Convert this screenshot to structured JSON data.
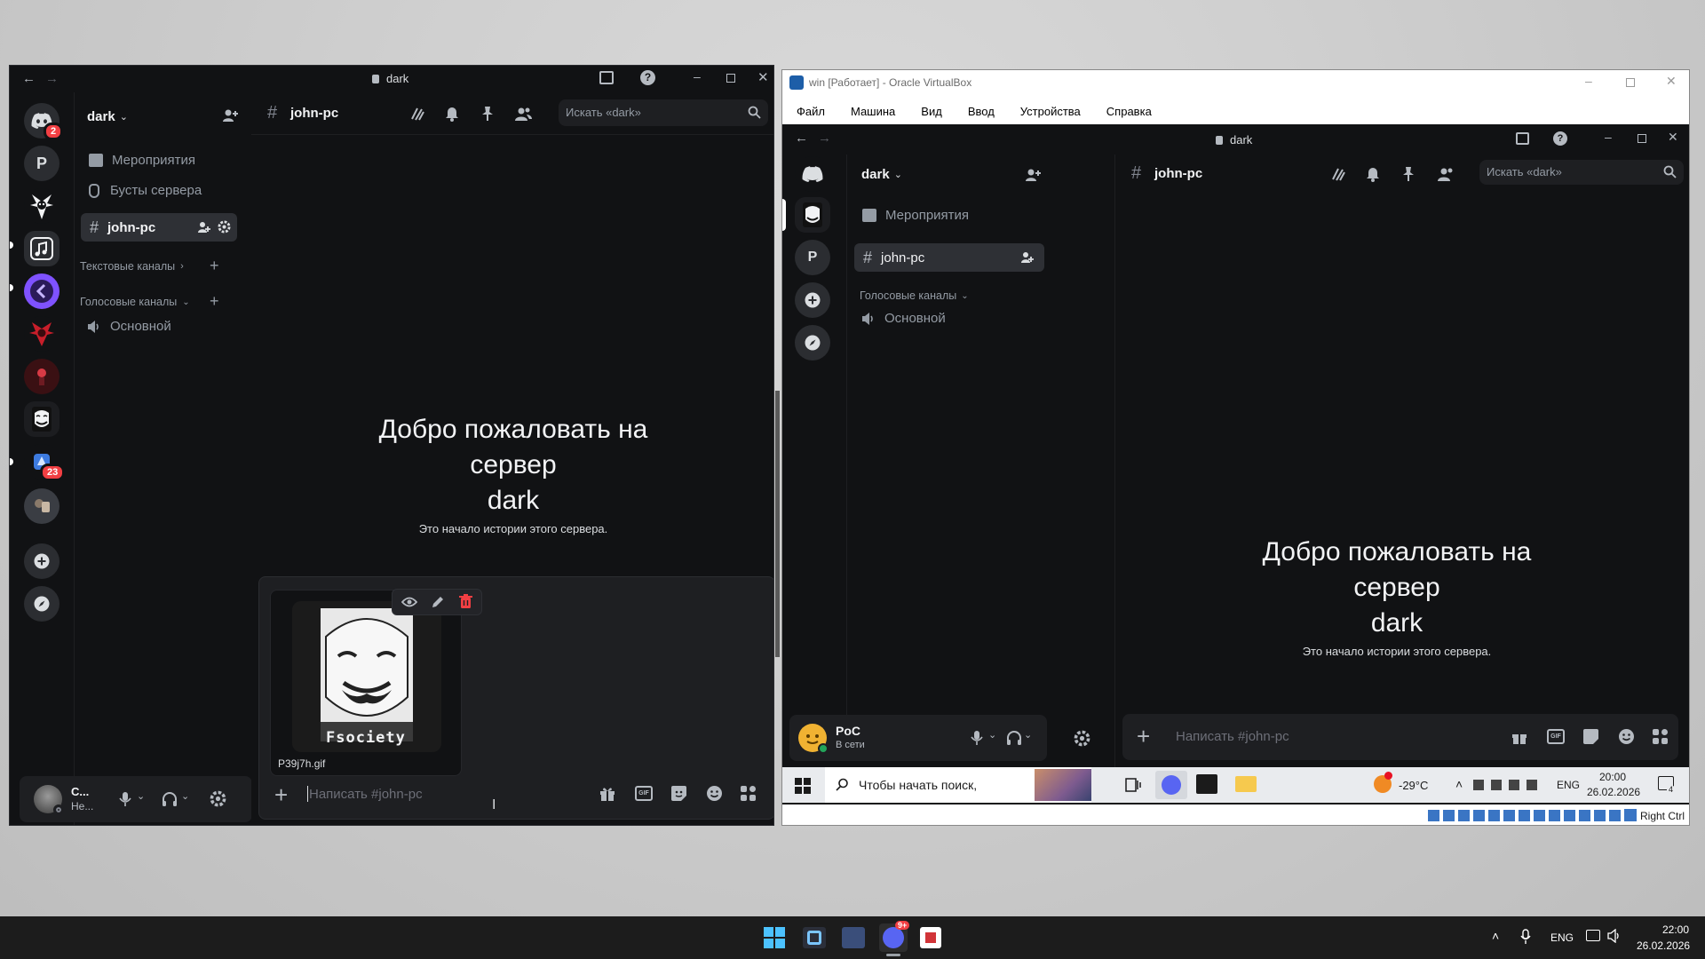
{
  "left_window": {
    "title": "dark",
    "server_name": "dark",
    "channel_name": "john-pc",
    "search_placeholder": "Искать «dark»",
    "events_label": "Мероприятия",
    "boosts_label": "Бусты сервера",
    "selected_channel": "john-pc",
    "text_category": "Текстовые каналы",
    "voice_category": "Голосовые каналы",
    "voice_channel": "Основной",
    "welcome_line1": "Добро пожаловать на",
    "welcome_line2": "сервер",
    "welcome_line3": "dark",
    "welcome_sub": "Это начало истории этого сервера.",
    "attachment_filename": "P39j7h.gif",
    "attachment_caption": "Fsociety",
    "message_placeholder": "Написать #john-pc",
    "user_name": "С...",
    "user_status": "Не...",
    "server_rail": [
      {
        "label": "",
        "badge": "2",
        "icon": "discord-icon"
      },
      {
        "label": "P",
        "badge": "",
        "icon": "letter"
      },
      {
        "label": "",
        "badge": "",
        "icon": "jester-icon"
      },
      {
        "label": "",
        "badge": "",
        "icon": "music-icon"
      },
      {
        "label": "",
        "badge": "",
        "icon": "kotlin-icon"
      },
      {
        "label": "",
        "badge": "",
        "icon": "red-jester-icon"
      },
      {
        "label": "",
        "badge": "",
        "icon": "dark-red-icon"
      },
      {
        "label": "",
        "badge": "",
        "icon": "mask-icon"
      },
      {
        "label": "",
        "badge": "23",
        "icon": "blue-icon"
      },
      {
        "label": "",
        "badge": "",
        "icon": "photo-icon"
      }
    ]
  },
  "vbox_window": {
    "title": "win [Работает] - Oracle VirtualBox",
    "menu": [
      "Файл",
      "Машина",
      "Вид",
      "Ввод",
      "Устройства",
      "Справка"
    ],
    "inner_title": "dark",
    "server_name": "dark",
    "channel_name": "john-pc",
    "search_placeholder": "Искать «dark»",
    "events_label": "Мероприятия",
    "selected_channel": "john-pc",
    "voice_category": "Голосовые каналы",
    "voice_channel": "Основной",
    "welcome_line1": "Добро пожаловать на",
    "welcome_line2": "сервер",
    "welcome_line3": "dark",
    "welcome_sub": "Это начало истории этого сервера.",
    "user_name": "PoC",
    "user_status": "В сети",
    "message_placeholder": "Написать #john-pc",
    "rail": [
      {
        "label": "",
        "icon": "mask-icon"
      },
      {
        "label": "P",
        "icon": "letter"
      },
      {
        "label": "",
        "icon": "plus-icon"
      },
      {
        "label": "",
        "icon": "compass-icon"
      }
    ],
    "guest_taskbar": {
      "search_placeholder": "Чтобы начать поиск,",
      "weather": "-29°C",
      "lang": "ENG",
      "time": "20:00",
      "date": "26.02.2026",
      "notif_count": "4"
    },
    "host_key": "Right Ctrl"
  },
  "host_taskbar": {
    "lang": "ENG",
    "time": "22:00",
    "date": "26.02.2026",
    "discord_badge": "9+"
  },
  "colors": {
    "discord_bg": "#111214",
    "accent": "#5865f2",
    "danger": "#f23f43",
    "online": "#23a55a"
  }
}
